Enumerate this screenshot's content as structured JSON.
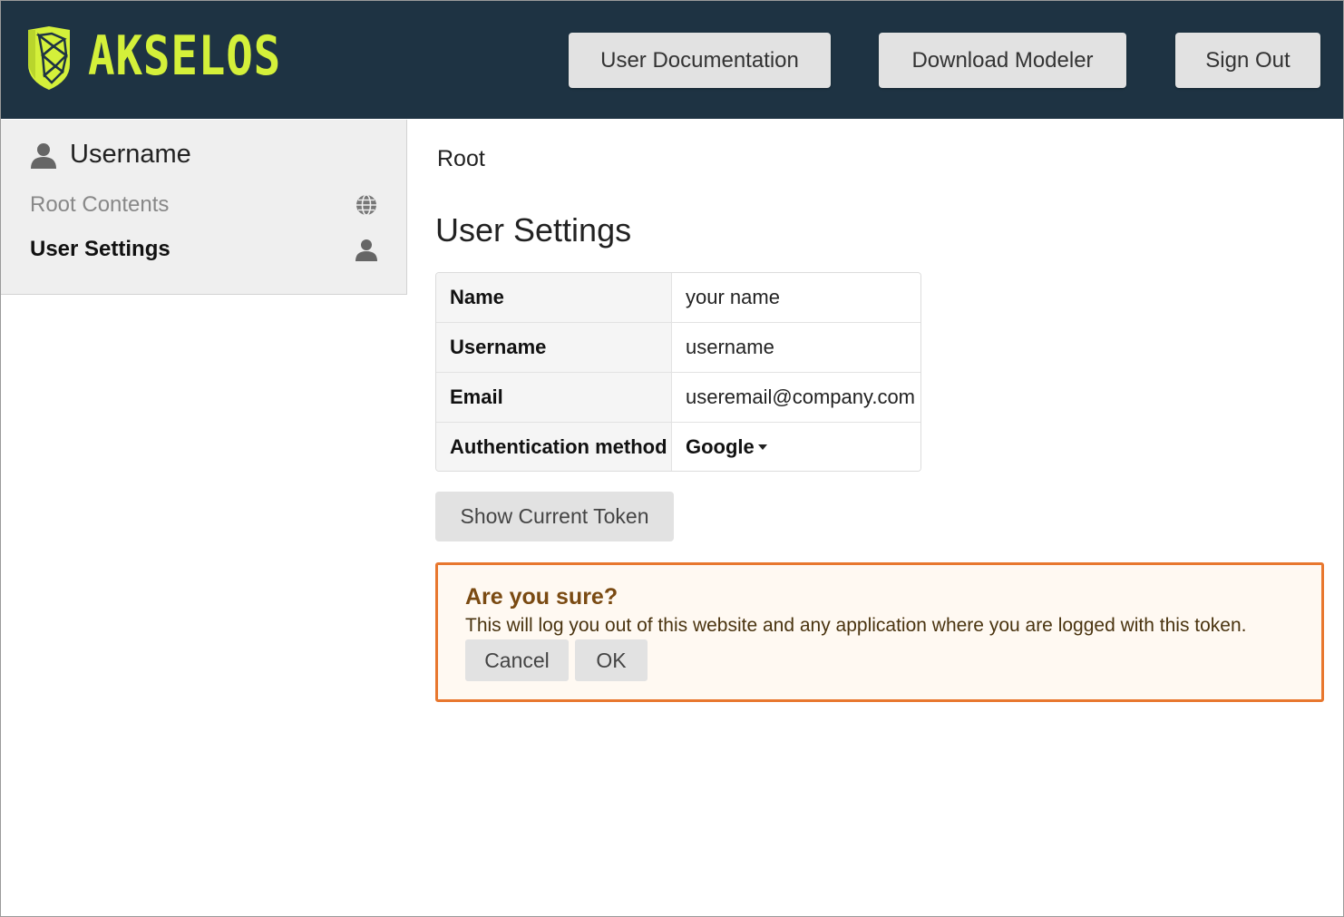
{
  "header": {
    "logo_text": "AKSELOS",
    "buttons": {
      "docs": "User Documentation",
      "download": "Download Modeler",
      "signout": "Sign Out"
    },
    "colors": {
      "bar": "#1e3343",
      "brand": "#d4f03a"
    }
  },
  "sidebar": {
    "user": {
      "name": "Username",
      "icon": "user-icon"
    },
    "items": [
      {
        "label": "Root Contents",
        "icon": "globe-icon",
        "active": false
      },
      {
        "label": "User Settings",
        "icon": "user-icon",
        "active": true
      }
    ]
  },
  "main": {
    "breadcrumb": "Root",
    "title": "User Settings",
    "settings": [
      {
        "label": "Name",
        "value": "your name"
      },
      {
        "label": "Username",
        "value": "username"
      },
      {
        "label": "Email",
        "value": "useremail@company.com"
      },
      {
        "label": "Authentication method",
        "value": "Google"
      }
    ],
    "token_button": "Show Current Token"
  },
  "confirm": {
    "title": "Are you sure?",
    "message": "This will log you out of this website and any application where you are logged with this token.",
    "cancel_label": "Cancel",
    "ok_label": "OK",
    "accent_color": "#e8772e"
  }
}
